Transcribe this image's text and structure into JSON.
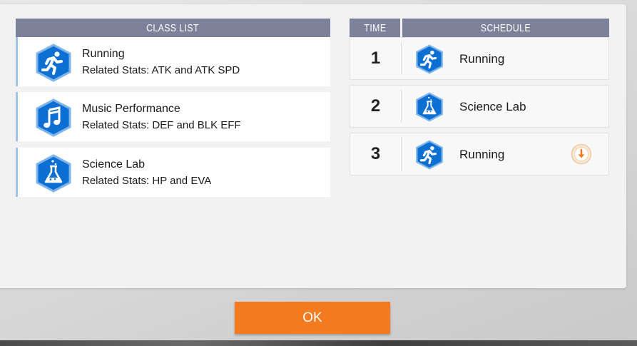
{
  "headers": {
    "class_list": "CLASS LIST",
    "time": "TIME",
    "schedule": "SCHEDULE"
  },
  "classes": [
    {
      "title": "Running",
      "stats": "Related Stats: ATK and ATK SPD",
      "icon": "runner-icon"
    },
    {
      "title": "Music Performance",
      "stats": "Related Stats: DEF and BLK EFF",
      "icon": "music-note-icon"
    },
    {
      "title": "Science Lab",
      "stats": "Related Stats: HP and EVA",
      "icon": "flask-icon"
    }
  ],
  "schedule": [
    {
      "time": "1",
      "label": "Running",
      "icon": "runner-icon"
    },
    {
      "time": "2",
      "label": "Science Lab",
      "icon": "flask-icon"
    },
    {
      "time": "3",
      "label": "Running",
      "icon": "runner-icon",
      "action_icon": "arrow-down-circle-icon"
    }
  ],
  "ok_label": "OK",
  "colors": {
    "header_bg": "#7d8199",
    "hex_blue": "#0e6fd2",
    "hex_border": "#7fb5ea",
    "ok_orange": "#f47a1f",
    "card_accent": "#9ec3e6"
  }
}
